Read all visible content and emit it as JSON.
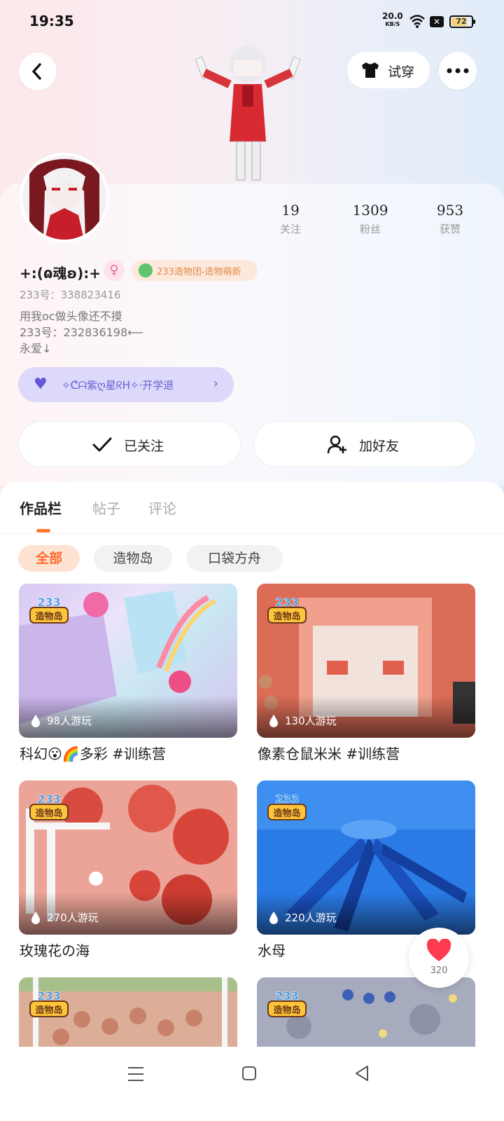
{
  "status_bar": {
    "time": "19:35",
    "net_speed": "20.0",
    "net_unit": "KB/S",
    "battery": "72",
    "colors": {
      "battery_fill": "#f2d27a"
    }
  },
  "header": {
    "try_on_label": "试穿",
    "icons": [
      "back-arrow-icon",
      "shirt-icon",
      "more-dots-icon"
    ]
  },
  "profile": {
    "stats": [
      {
        "value": "19",
        "label": "关注"
      },
      {
        "value": "1309",
        "label": "粉丝"
      },
      {
        "value": "953",
        "label": "获赞"
      }
    ],
    "username": "+:(ɷ魂ʚ):+",
    "gender_symbol": "♀",
    "guild_label": "233造物团-造物萌新",
    "uid": "233号：338823416",
    "bio": "用我oc做头像还不摸\n233号：232836198⟵\n永爱↓",
    "family_label": "✧ᕦᗩ紫ღ星ᖇᕼ✧·开学退",
    "follow_label": "已关注",
    "add_friend_label": "加好友"
  },
  "tabs": [
    {
      "label": "作品栏",
      "active": true
    },
    {
      "label": "帖子",
      "active": false
    },
    {
      "label": "评论",
      "active": false
    }
  ],
  "filters": [
    {
      "label": "全部",
      "active": true
    },
    {
      "label": "造物岛",
      "active": false
    },
    {
      "label": "口袋方舟",
      "active": false
    }
  ],
  "badge_text": {
    "top": "233",
    "bottom": "造物岛"
  },
  "games": [
    {
      "title": "科幻😮🌈多彩 #训练营",
      "plays": "98人游玩"
    },
    {
      "title": "像素仓鼠米米 #训练营",
      "plays": "130人游玩"
    },
    {
      "title": "玫瑰花の海",
      "plays": "270人游玩"
    },
    {
      "title": "水母",
      "plays": "220人游玩"
    },
    {
      "title": "",
      "plays": ""
    },
    {
      "title": "",
      "plays": ""
    }
  ],
  "like": {
    "count": "320"
  },
  "colors": {
    "accent": "#ff7a2f",
    "family_bg": "#dcd9fa",
    "like": "#ff3b4f"
  }
}
